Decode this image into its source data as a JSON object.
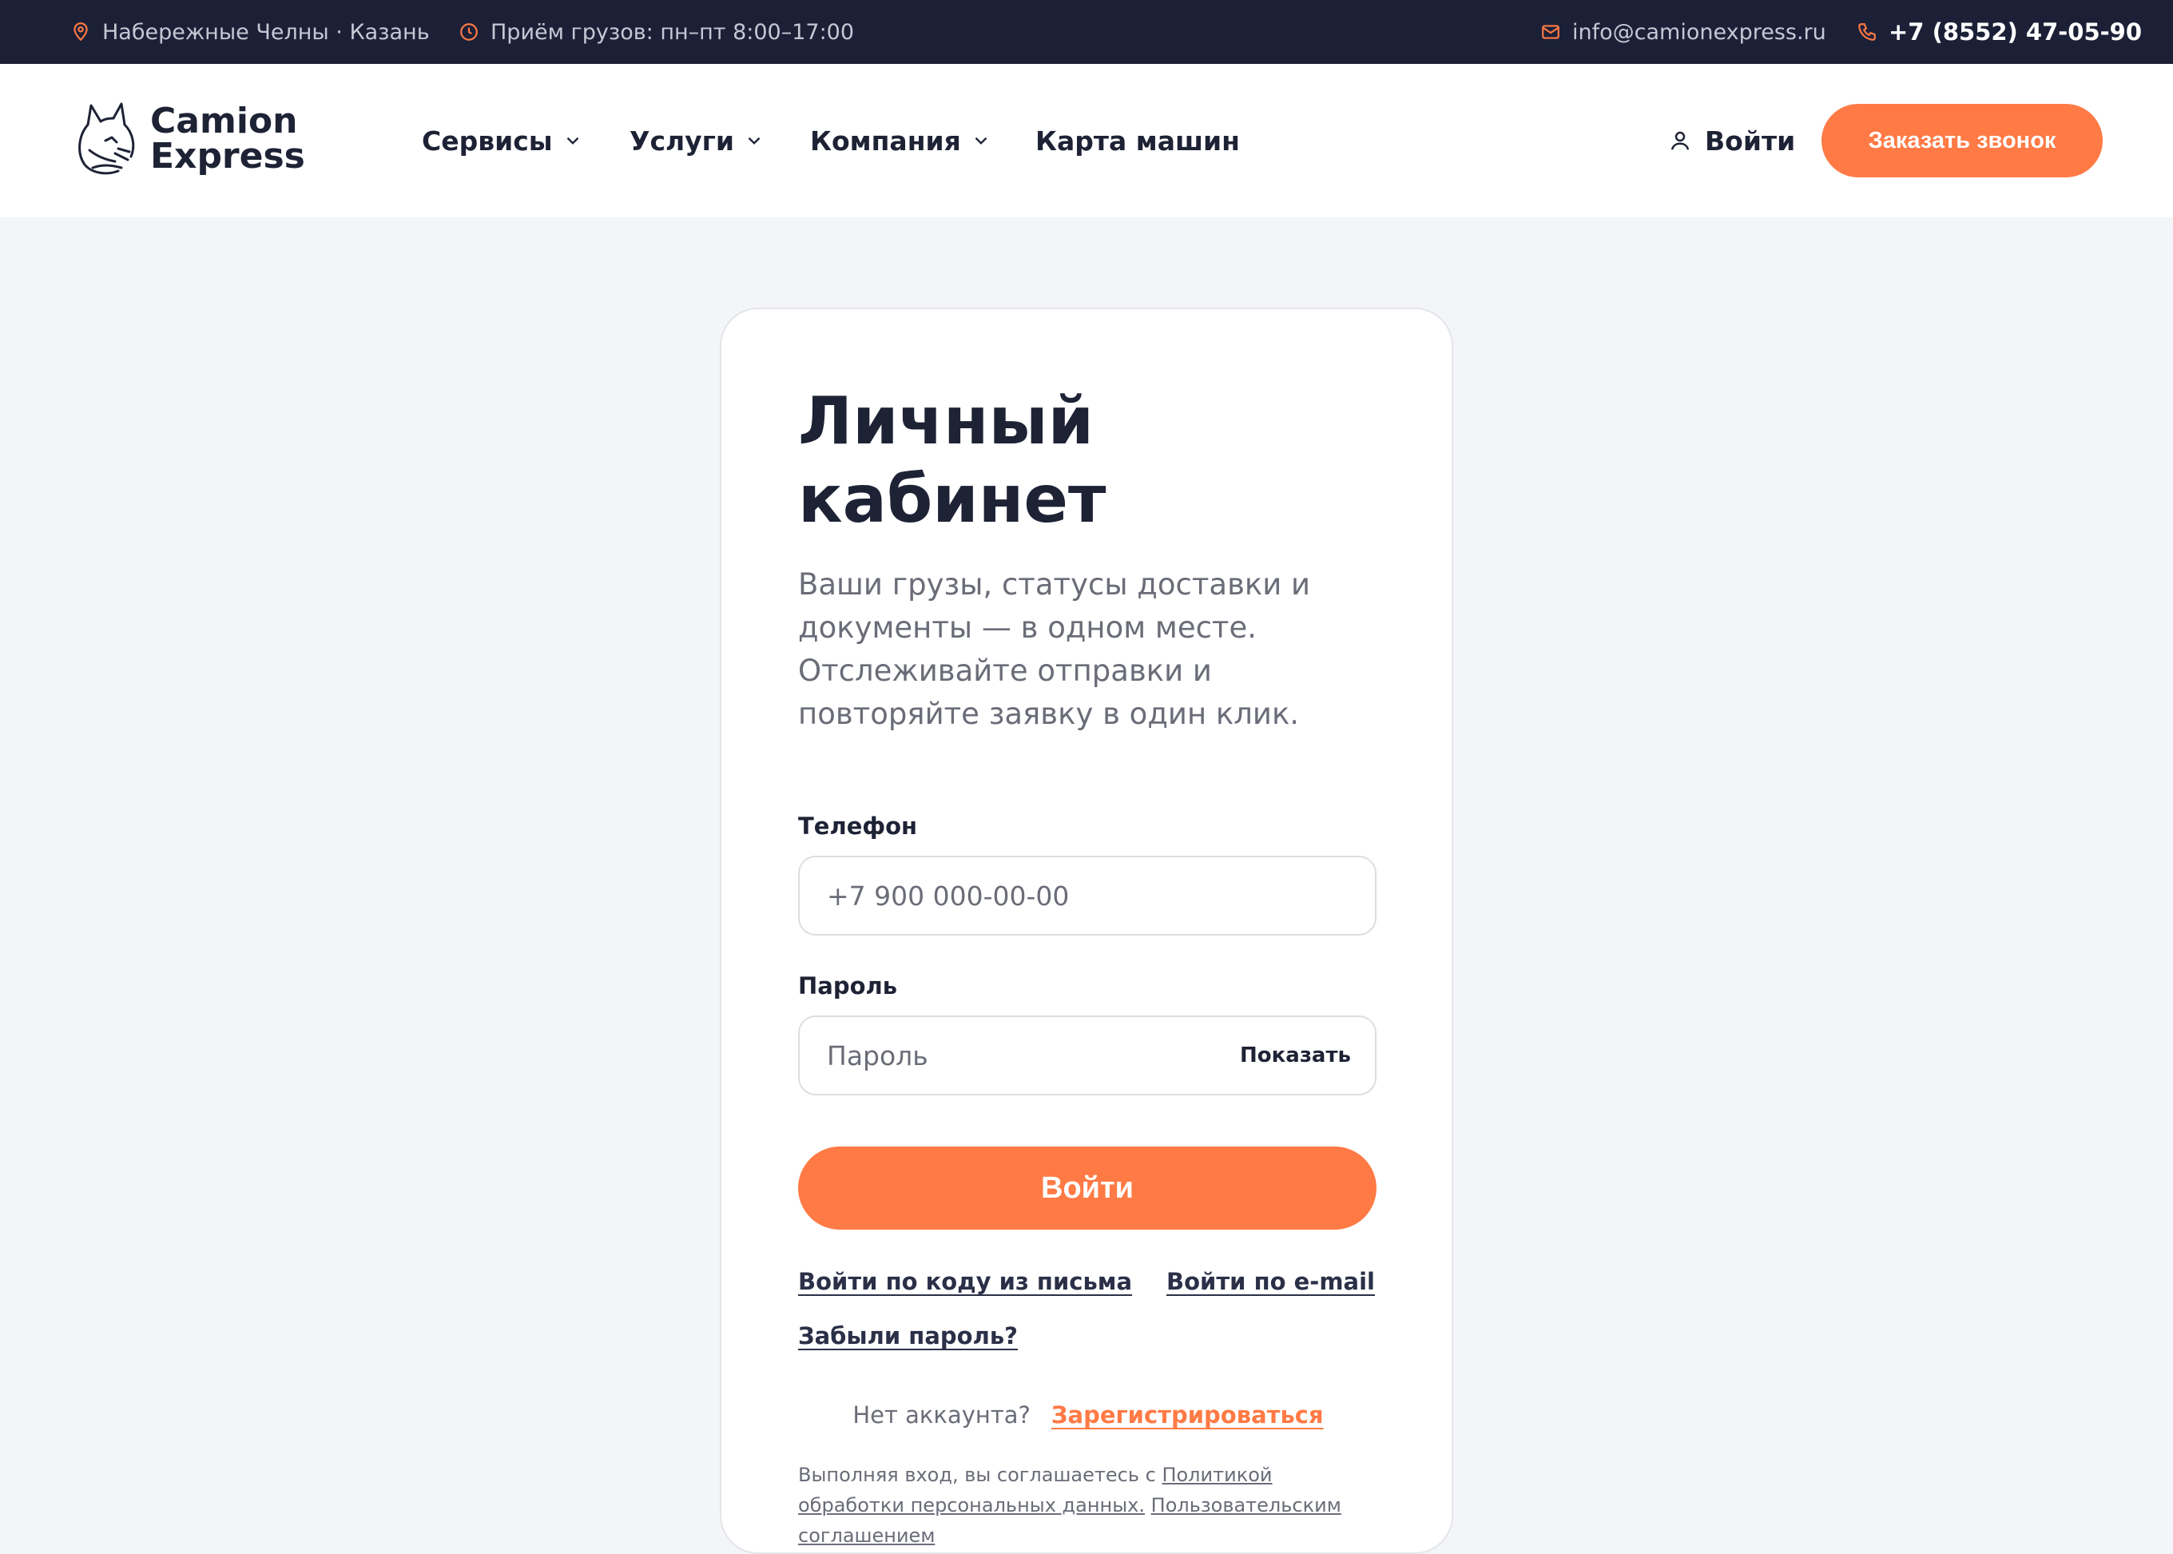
{
  "topbar": {
    "location": "Набережные Челны · Казань",
    "hours": "Приём грузов: пн–пт 8:00–17:00",
    "email": "info@camionexpress.ru",
    "phone": "+7 (8552) 47-05-90"
  },
  "header": {
    "logo_line1": "Camion",
    "logo_line2": "Express",
    "nav": [
      {
        "label": "Сервисы"
      },
      {
        "label": "Услуги"
      },
      {
        "label": "Компания"
      },
      {
        "label": "Карта машин"
      }
    ],
    "login": "Войти",
    "call_button": "Заказать звонок"
  },
  "login_card": {
    "title_line1": "Личный",
    "title_line2": "кабинет",
    "subtitle": "Ваши грузы, статусы доставки и документы — в одном месте. Отслеживайте отправки и повторяйте заявку в один клик.",
    "phone_label": "Телефон",
    "phone_placeholder": "+7 900 000-00-00",
    "password_label": "Пароль",
    "password_placeholder": "Пароль",
    "show_password": "Показать",
    "submit": "Войти",
    "code_login": "Войти по коду из письма",
    "email_login": "Войти по e-mail",
    "forgot": "Забыли пароль?",
    "no_account": "Нет аккаунта?",
    "register": "Зарегистрироваться",
    "consent_prefix": "Выполняя вход, вы соглашаетесь с",
    "consent_policy": "Политикой обработки персональных данных.",
    "consent_agreement": "Пользовательским соглашением"
  },
  "colors": {
    "accent": "#ff7a45",
    "topbar_bg": "#1c2037",
    "text_dark": "#1e2235",
    "text_muted": "#6a6d78",
    "page_bg": "#f4f5f8"
  }
}
